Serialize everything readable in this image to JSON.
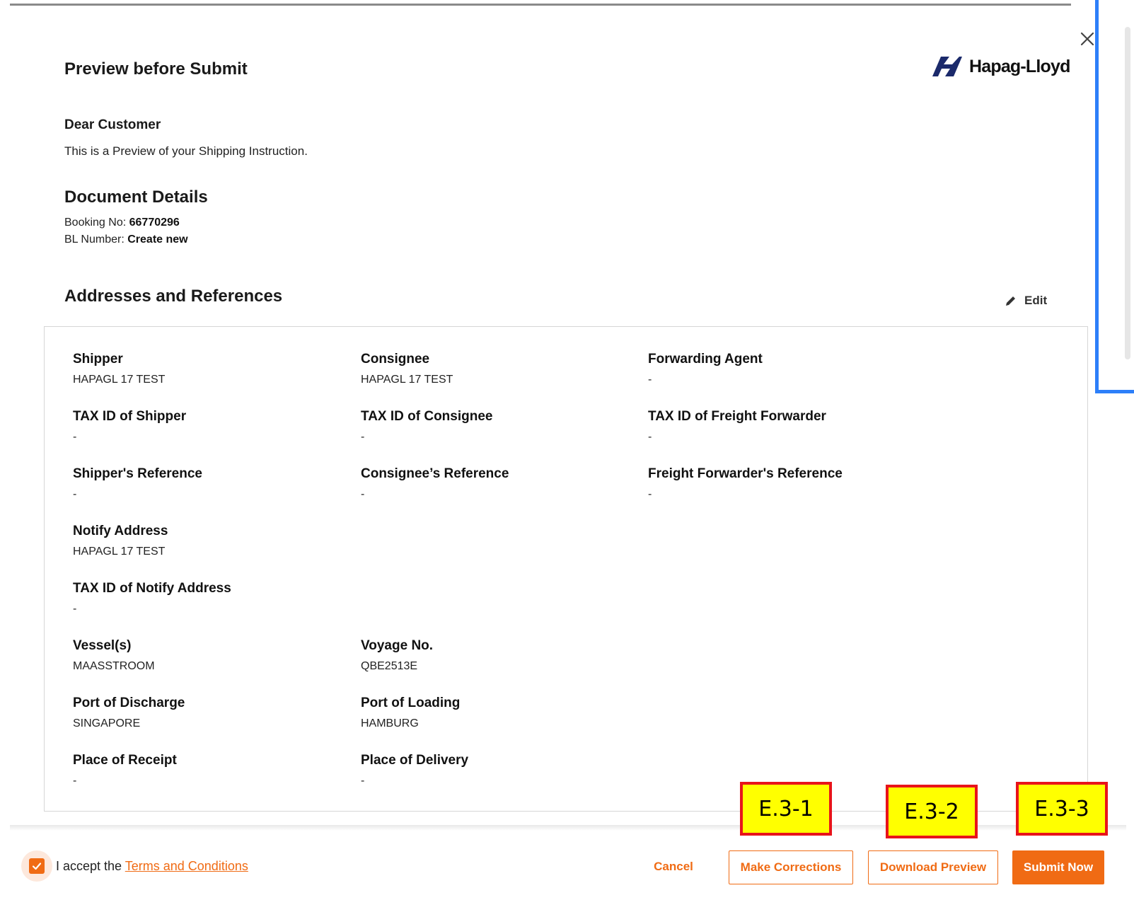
{
  "dialog": {
    "title": "Preview before Submit",
    "brand": "Hapag-Lloyd",
    "greeting": "Dear Customer",
    "intro": "This is a Preview of your Shipping Instruction."
  },
  "document_details": {
    "heading": "Document Details",
    "booking_label": "Booking No:",
    "booking_value": "66770296",
    "bl_label": "BL Number:",
    "bl_value": "Create new"
  },
  "addresses": {
    "heading": "Addresses and References",
    "edit_label": "Edit",
    "fields": [
      {
        "label": "Shipper",
        "value": "HAPAGL 17 TEST"
      },
      {
        "label": "Consignee",
        "value": "HAPAGL 17 TEST"
      },
      {
        "label": "Forwarding Agent",
        "value": "-"
      },
      {
        "label": "TAX ID of Shipper",
        "value": "-"
      },
      {
        "label": "TAX ID of Consignee",
        "value": "-"
      },
      {
        "label": "TAX ID of Freight Forwarder",
        "value": "-"
      },
      {
        "label": "Shipper's Reference",
        "value": "-"
      },
      {
        "label": "Consignee’s Reference",
        "value": "-"
      },
      {
        "label": "Freight Forwarder's Reference",
        "value": "-"
      },
      {
        "label": "Notify Address",
        "value": "HAPAGL 17 TEST"
      },
      {
        "label": "TAX ID of Notify Address",
        "value": "-"
      },
      {
        "label": "Vessel(s)",
        "value": "MAASSTROOM"
      },
      {
        "label": "Voyage No.",
        "value": "QBE2513E"
      },
      {
        "label": "Port of Discharge",
        "value": "SINGAPORE"
      },
      {
        "label": "Port of Loading",
        "value": "HAMBURG"
      },
      {
        "label": "Place of Receipt",
        "value": "-"
      },
      {
        "label": "Place of Delivery",
        "value": "-"
      }
    ]
  },
  "footer": {
    "accept_prefix": "I accept the",
    "terms_link": "Terms and Conditions",
    "cancel_label": "Cancel",
    "corrections_label": "Make Corrections",
    "download_label": "Download Preview",
    "submit_label": "Submit Now"
  },
  "annotations": {
    "tag1": "E.3-1",
    "tag2": "E.3-2",
    "tag3": "E.3-3"
  },
  "icons": {
    "close": "close-icon",
    "edit": "pencil-icon",
    "checkbox": "checkmark-icon",
    "logo": "hapag-lloyd-logo"
  },
  "colors": {
    "accent": "#f06b14",
    "annotation_fill": "#ffff00",
    "annotation_border": "#e8141a",
    "frame_blue": "#2d7ff9",
    "logo_navy": "#1b2a6b"
  }
}
